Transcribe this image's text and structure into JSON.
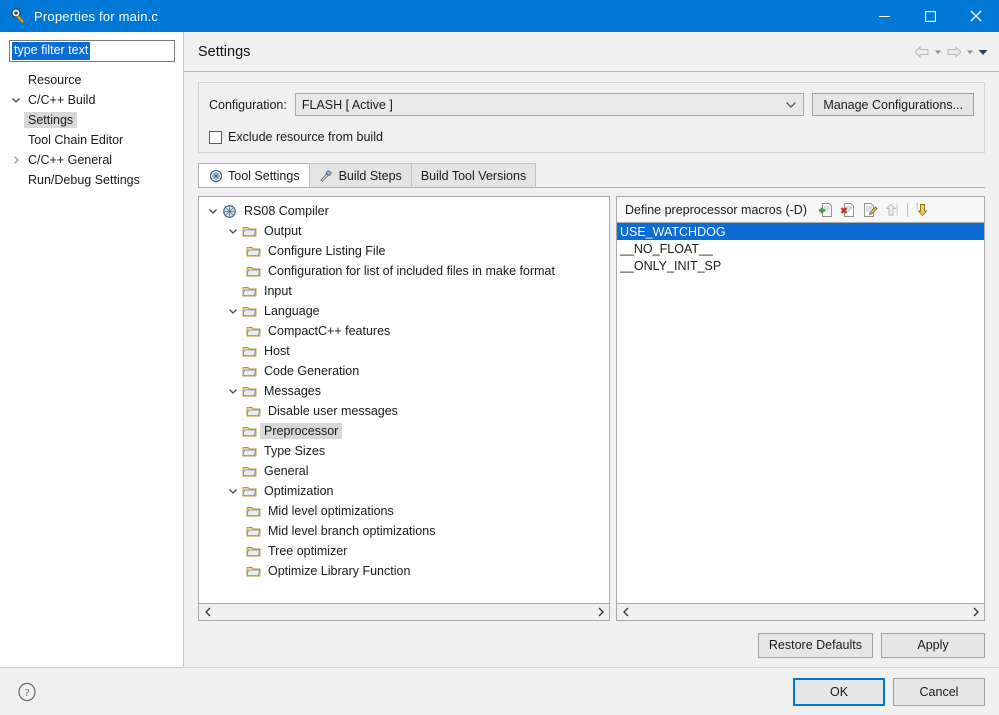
{
  "window": {
    "title": "Properties for main.c",
    "icon": "properties-icon",
    "controls": {
      "minimize": "minimize",
      "maximize": "maximize",
      "close": "close"
    }
  },
  "sidebar": {
    "filter": {
      "value": "type filter text",
      "placeholder": "type filter text"
    },
    "items": [
      {
        "label": "Resource",
        "level": 1,
        "twisty": "none",
        "selected": false
      },
      {
        "label": "C/C++ Build",
        "level": 0,
        "twisty": "expanded",
        "selected": false
      },
      {
        "label": "Settings",
        "level": 2,
        "twisty": "none",
        "selected": true
      },
      {
        "label": "Tool Chain Editor",
        "level": 2,
        "twisty": "none",
        "selected": false
      },
      {
        "label": "C/C++ General",
        "level": 0,
        "twisty": "collapsed",
        "selected": false
      },
      {
        "label": "Run/Debug Settings",
        "level": 1,
        "twisty": "none",
        "selected": false
      }
    ]
  },
  "header": {
    "title": "Settings",
    "nav": {
      "back": "back-arrow",
      "back_menu": "chevron-down",
      "forward": "forward-arrow",
      "forward_menu": "chevron-down",
      "view_menu": "chevron-down-filled"
    }
  },
  "config": {
    "label": "Configuration:",
    "value": "FLASH  [ Active ]",
    "manage_button": "Manage Configurations...",
    "exclude_checkbox": {
      "label": "Exclude resource from build",
      "checked": false
    }
  },
  "tabs": [
    {
      "label": "Tool Settings",
      "icon": "tool-settings-icon",
      "active": true
    },
    {
      "label": "Build Steps",
      "icon": "build-steps-icon",
      "active": false
    },
    {
      "label": "Build Tool Versions",
      "icon": "none",
      "active": false
    }
  ],
  "tool_tree": [
    {
      "label": "RS08 Compiler",
      "level": 0,
      "twisty": "expanded",
      "icon": "compiler-icon",
      "selected": false
    },
    {
      "label": "Output",
      "level": 1,
      "twisty": "expanded",
      "icon": "folder-icon",
      "selected": false
    },
    {
      "label": "Configure Listing File",
      "level": 2,
      "twisty": "none",
      "icon": "folder-icon",
      "selected": false
    },
    {
      "label": "Configuration for list of included files in make format",
      "level": 2,
      "twisty": "none",
      "icon": "folder-icon",
      "selected": false
    },
    {
      "label": "Input",
      "level": 1,
      "twisty": "none",
      "icon": "folder-icon",
      "selected": false
    },
    {
      "label": "Language",
      "level": 1,
      "twisty": "expanded",
      "icon": "folder-icon",
      "selected": false
    },
    {
      "label": "CompactC++ features",
      "level": 2,
      "twisty": "none",
      "icon": "folder-icon",
      "selected": false
    },
    {
      "label": "Host",
      "level": 1,
      "twisty": "none",
      "icon": "folder-icon",
      "selected": false
    },
    {
      "label": "Code Generation",
      "level": 1,
      "twisty": "none",
      "icon": "folder-icon",
      "selected": false
    },
    {
      "label": "Messages",
      "level": 1,
      "twisty": "expanded",
      "icon": "folder-icon",
      "selected": false
    },
    {
      "label": "Disable user messages",
      "level": 2,
      "twisty": "none",
      "icon": "folder-icon",
      "selected": false
    },
    {
      "label": "Preprocessor",
      "level": 1,
      "twisty": "none",
      "icon": "folder-icon",
      "selected": true
    },
    {
      "label": "Type Sizes",
      "level": 1,
      "twisty": "none",
      "icon": "folder-icon",
      "selected": false
    },
    {
      "label": "General",
      "level": 1,
      "twisty": "none",
      "icon": "folder-icon",
      "selected": false
    },
    {
      "label": "Optimization",
      "level": 1,
      "twisty": "expanded",
      "icon": "folder-icon",
      "selected": false
    },
    {
      "label": "Mid level optimizations",
      "level": 2,
      "twisty": "none",
      "icon": "folder-icon",
      "selected": false
    },
    {
      "label": "Mid level branch optimizations",
      "level": 2,
      "twisty": "none",
      "icon": "folder-icon",
      "selected": false
    },
    {
      "label": "Tree optimizer",
      "level": 2,
      "twisty": "none",
      "icon": "folder-icon",
      "selected": false
    },
    {
      "label": "Optimize Library Function",
      "level": 2,
      "twisty": "none",
      "icon": "folder-icon",
      "selected": false
    }
  ],
  "macros": {
    "title": "Define preprocessor macros (-D)",
    "tools": [
      {
        "name": "add-icon",
        "enabled": true
      },
      {
        "name": "delete-icon",
        "enabled": true
      },
      {
        "name": "edit-icon",
        "enabled": true
      },
      {
        "name": "move-up-icon",
        "enabled": false
      },
      {
        "name": "move-down-icon",
        "enabled": true
      }
    ],
    "items": [
      {
        "value": "USE_WATCHDOG",
        "selected": true
      },
      {
        "value": "__NO_FLOAT__",
        "selected": false
      },
      {
        "value": "__ONLY_INIT_SP",
        "selected": false
      }
    ]
  },
  "actions": {
    "restore_defaults": "Restore Defaults",
    "apply": "Apply"
  },
  "footer": {
    "help": "help-icon",
    "ok": "OK",
    "cancel": "Cancel"
  },
  "colors": {
    "titlebar": "#0078d7",
    "selection": "#0a6cd4",
    "row_selection": "#d8d8d8",
    "dialog_bg": "#f0f0f0",
    "focus_border": "#0078d7"
  }
}
